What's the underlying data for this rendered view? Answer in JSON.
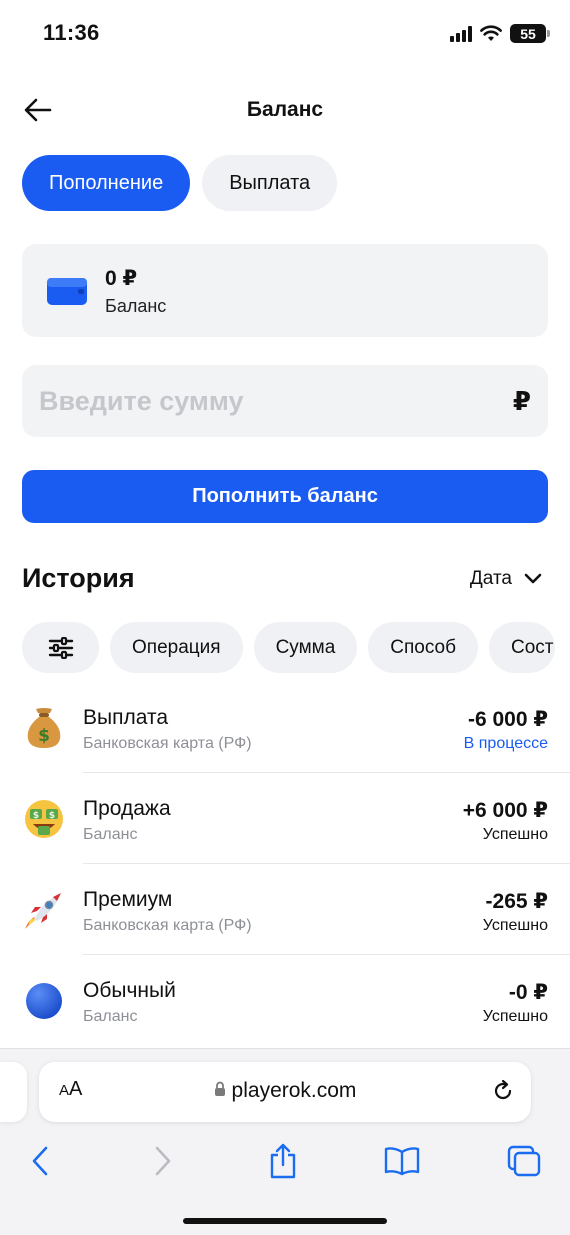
{
  "status_bar": {
    "time": "11:36",
    "battery": "55"
  },
  "header": {
    "title": "Баланс"
  },
  "tabs": [
    {
      "label": "Пополнение",
      "active": true
    },
    {
      "label": "Выплата",
      "active": false
    }
  ],
  "balance": {
    "amount": "0 ₽",
    "label": "Баланс"
  },
  "amount_input": {
    "placeholder": "Введите сумму",
    "value": "",
    "currency": "₽"
  },
  "topup_button": {
    "label": "Пополнить баланс"
  },
  "history": {
    "title": "История",
    "sort_label": "Дата",
    "filters": [
      "Операция",
      "Сумма",
      "Способ",
      "Сост"
    ],
    "transactions": [
      {
        "icon": "money-bag-icon",
        "name": "Выплата",
        "method": "Банковская карта (РФ)",
        "amount": "-6 000 ₽",
        "status": "В процессе"
      },
      {
        "icon": "money-face-icon",
        "name": "Продажа",
        "method": "Баланс",
        "amount": "+6 000 ₽",
        "status": "Успешно"
      },
      {
        "icon": "rocket-icon",
        "name": "Премиум",
        "method": "Банковская карта (РФ)",
        "amount": "-265 ₽",
        "status": "Успешно"
      },
      {
        "icon": "blue-circle-icon",
        "name": "Обычный",
        "method": "Баланс",
        "amount": "-0 ₽",
        "status": "Успешно"
      }
    ]
  },
  "browser": {
    "aa_label_small": "A",
    "aa_label_large": "A",
    "url": "playerok.com"
  },
  "colors": {
    "accent": "#1a5cf2",
    "surface": "#f2f3f5",
    "muted_text": "#8e9097"
  }
}
